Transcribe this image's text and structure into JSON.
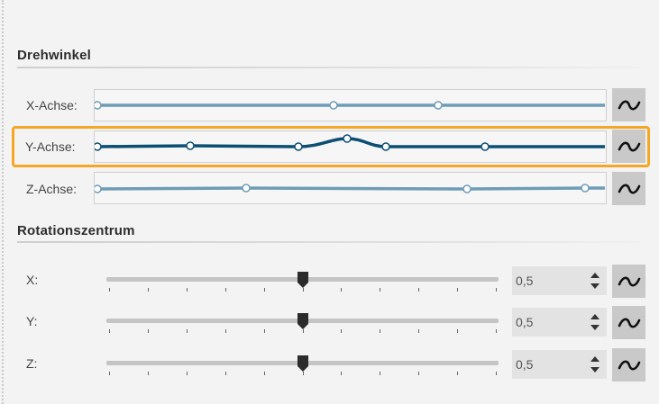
{
  "sections": {
    "rotation_angle": {
      "title": "Drehwinkel"
    },
    "rotation_center": {
      "title": "Rotationszentrum"
    }
  },
  "curves": [
    {
      "label": "X-Achse:",
      "selected": false
    },
    {
      "label": "Y-Achse:",
      "selected": true
    },
    {
      "label": "Z-Achse:",
      "selected": false
    }
  ],
  "center": [
    {
      "label": "X:",
      "value": "0,5",
      "slider_fraction": 0.5
    },
    {
      "label": "Y:",
      "value": "0,5",
      "slider_fraction": 0.5
    },
    {
      "label": "Z:",
      "value": "0,5",
      "slider_fraction": 0.5
    }
  ],
  "icons": {
    "curve_toggle": "tilde-icon",
    "spinner": "up-down-arrows-icon",
    "slider_thumb": "slider-thumb-icon"
  },
  "colors": {
    "curve_light": "#6e9cb5",
    "curve_dark": "#0c4f73",
    "highlight": "#f5a623",
    "button_bg": "#c9c9c9"
  }
}
